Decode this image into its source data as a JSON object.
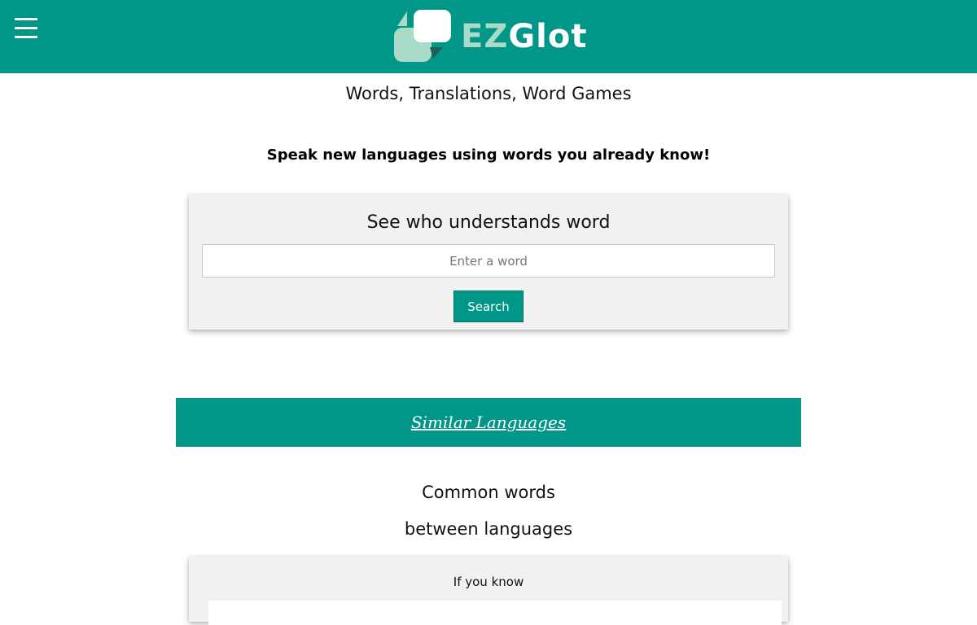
{
  "header": {
    "menu_icon": "hamburger-menu-icon",
    "logo_icon": "chat-bubbles-icon",
    "logo_part1": "EZ",
    "logo_part2": "Glot",
    "bg_color": "#009688"
  },
  "tagline": "Words, Translations, Word Games",
  "subtagline": "Speak new languages using words you already know!",
  "search_card": {
    "title": "See who understands word",
    "input_placeholder": "Enter a word",
    "input_value": "",
    "button_label": "Search"
  },
  "similar_languages_link": "Similar Languages",
  "common_words": {
    "line1": "Common words",
    "line2": "between languages"
  },
  "know_card": {
    "label": "If you know"
  },
  "colors": {
    "accent": "#009688",
    "logo_light": "#a8dcc9",
    "card_bg": "#f1f1f1"
  }
}
